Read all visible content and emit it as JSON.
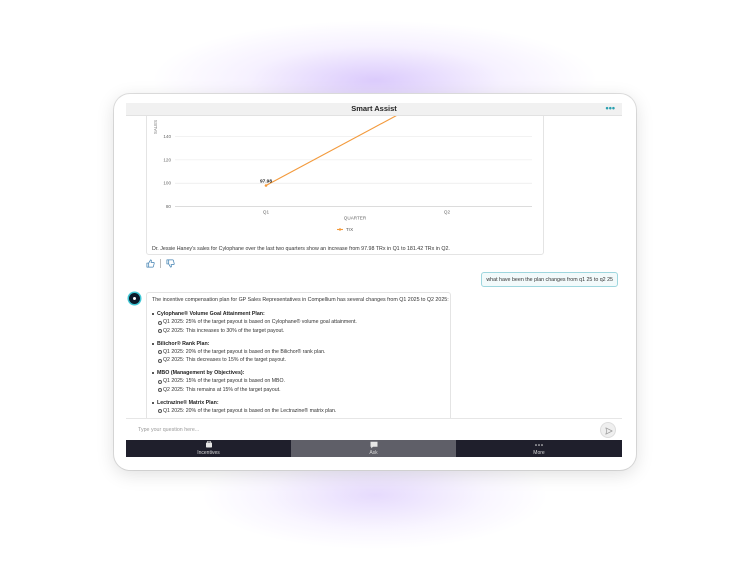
{
  "header": {
    "title": "Smart Assist",
    "more_icon": "more-dots-icon"
  },
  "chart_data": {
    "type": "line",
    "categories": [
      "Q1",
      "Q2"
    ],
    "series": [
      {
        "name": "TrX",
        "values": [
          97.98,
          181.42
        ],
        "color": "#f39a3c"
      }
    ],
    "data_labels": [
      "97.98"
    ],
    "xlabel": "QUARTER",
    "ylabel": "SALES",
    "yticks": [
      80,
      100,
      120,
      140
    ],
    "grid": true,
    "legend": "bottom"
  },
  "chart_summary": "Dr. Jessie Haney's sales for Cylophane over the last two quarters show an increase from 97.98 TRx in Q1 to 181.42 TRx in Q2.",
  "feedback": {
    "like_icon": "thumbs-up-icon",
    "dislike_icon": "thumbs-down-icon"
  },
  "user_message": "what have been the plan changes from q1 25 to q2 25",
  "answer": {
    "intro": "The incentive compensation plan for GP Sales Representatives in Compellium has several changes from Q1 2025 to Q2 2025:",
    "plans": [
      {
        "name": "Cylophane® Volume Goal Attainment Plan:",
        "lines": [
          "Q1 2025: 25% of the target payout is based on Cylophane® volume goal attainment.",
          "Q2 2025: This increases to 30% of the target payout."
        ]
      },
      {
        "name": "Bilichor® Rank Plan:",
        "lines": [
          "Q1 2025: 20% of the target payout is based on the Bilichor® rank plan.",
          "Q2 2025: This decreases to 15% of the target payout."
        ]
      },
      {
        "name": "MBO (Management by Objectives):",
        "lines": [
          "Q1 2025: 15% of the target payout is based on MBO.",
          "Q2 2025: This remains at 15% of the target payout."
        ]
      },
      {
        "name": "Lectrazine® Matrix Plan:",
        "lines": [
          "Q1 2025: 20% of the target payout is based on the Lectrazine® matrix plan.",
          ""
        ]
      }
    ]
  },
  "input": {
    "placeholder": "Type your question here..."
  },
  "nav": [
    {
      "label": "Incentives",
      "icon": "incentives-icon"
    },
    {
      "label": "Ask",
      "icon": "chat-icon",
      "active": true
    },
    {
      "label": "More",
      "icon": "more-dots-icon"
    }
  ],
  "colors": {
    "accent": "#3fc6d4",
    "line": "#f39a3c",
    "nav_bg": "#1f1f2c",
    "nav_active": "#5f5f68"
  }
}
